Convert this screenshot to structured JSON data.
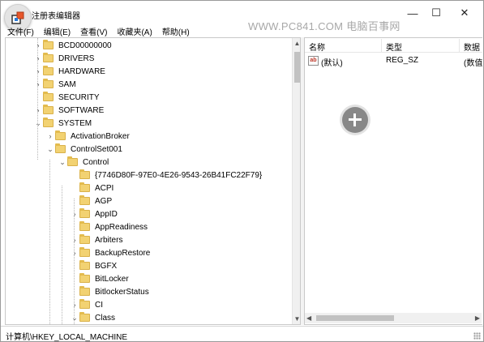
{
  "window": {
    "title": "注册表编辑器",
    "watermark": "WWW.PC841.COM 电脑百事网",
    "minimize_glyph": "—",
    "maximize_glyph": "☐",
    "close_glyph": "✕"
  },
  "menu": [
    {
      "label": "文件(F)"
    },
    {
      "label": "编辑(E)"
    },
    {
      "label": "查看(V)"
    },
    {
      "label": "收藏夹(A)"
    },
    {
      "label": "帮助(H)"
    }
  ],
  "tree": {
    "items": [
      {
        "label": "BCD00000000",
        "level": 0,
        "arrow": "›"
      },
      {
        "label": "DRIVERS",
        "level": 0,
        "arrow": "›"
      },
      {
        "label": "HARDWARE",
        "level": 0,
        "arrow": "›"
      },
      {
        "label": "SAM",
        "level": 0,
        "arrow": "›"
      },
      {
        "label": "SECURITY",
        "level": 0,
        "arrow": ""
      },
      {
        "label": "SOFTWARE",
        "level": 0,
        "arrow": "›"
      },
      {
        "label": "SYSTEM",
        "level": 0,
        "arrow": "⌄"
      },
      {
        "label": "ActivationBroker",
        "level": 1,
        "arrow": "›"
      },
      {
        "label": "ControlSet001",
        "level": 1,
        "arrow": "⌄"
      },
      {
        "label": "Control",
        "level": 2,
        "arrow": "⌄"
      },
      {
        "label": "{7746D80F-97E0-4E26-9543-26B41FC22F79}",
        "level": 3,
        "arrow": ""
      },
      {
        "label": "ACPI",
        "level": 3,
        "arrow": ""
      },
      {
        "label": "AGP",
        "level": 3,
        "arrow": ""
      },
      {
        "label": "AppID",
        "level": 3,
        "arrow": "›"
      },
      {
        "label": "AppReadiness",
        "level": 3,
        "arrow": ""
      },
      {
        "label": "Arbiters",
        "level": 3,
        "arrow": "›"
      },
      {
        "label": "BackupRestore",
        "level": 3,
        "arrow": "›"
      },
      {
        "label": "BGFX",
        "level": 3,
        "arrow": ""
      },
      {
        "label": "BitLocker",
        "level": 3,
        "arrow": ""
      },
      {
        "label": "BitlockerStatus",
        "level": 3,
        "arrow": ""
      },
      {
        "label": "CI",
        "level": 3,
        "arrow": "›"
      },
      {
        "label": "Class",
        "level": 3,
        "arrow": "⌄"
      }
    ]
  },
  "list": {
    "columns": [
      "名称",
      "类型",
      "数据"
    ],
    "rows": [
      {
        "icon": "ab",
        "name": "(默认)",
        "type": "REG_SZ",
        "data": "(数值"
      }
    ]
  },
  "status": {
    "path": "计算机\\HKEY_LOCAL_MACHINE"
  },
  "colors": {
    "folder": "#f2d272",
    "scroll_thumb": "#c2c2c2",
    "watermark": "#a8a8a8"
  }
}
